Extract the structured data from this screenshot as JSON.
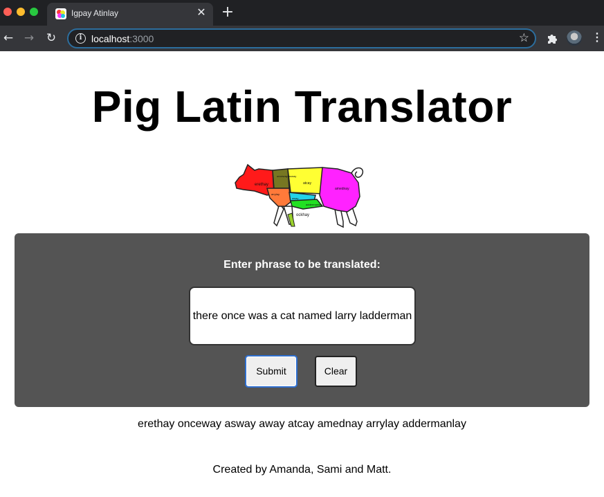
{
  "browser": {
    "tab_title": "Igpay Atinlay",
    "url_host": "localhost",
    "url_port": ":3000",
    "accent_color": "#2c6e9e",
    "icons": [
      "back-icon",
      "forward-icon",
      "reload-icon",
      "info-icon",
      "bookmark-star-icon",
      "extensions-icon",
      "profile-avatar",
      "menu-icon"
    ]
  },
  "page": {
    "title": "Pig Latin Translator",
    "image_alt": "pig-butcher-diagram",
    "pig_labels": {
      "head": "erethay",
      "neck": "onceway asway",
      "middle": "atcay",
      "rear": "amednay",
      "shoulder": "arrylay",
      "belly": "addermanlay",
      "loin": "away",
      "leg": "ockhay"
    }
  },
  "form": {
    "prompt": "Enter phrase to be translated:",
    "input_value": "there once was a cat named larry ladderman",
    "submit_label": "Submit",
    "clear_label": "Clear",
    "panel_color": "#545454"
  },
  "result": {
    "translation": "erethay onceway asway away atcay amednay arrylay addermanlay"
  },
  "footer": {
    "credit": "Created by Amanda, Sami and Matt."
  }
}
